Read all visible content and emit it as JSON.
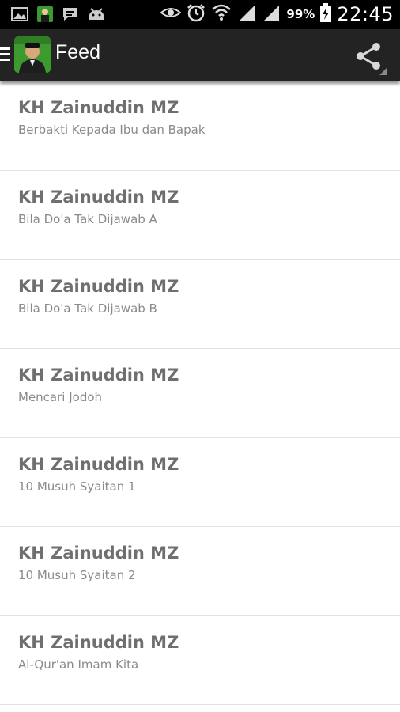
{
  "status_bar": {
    "notification_icons": [
      "gallery-icon",
      "app-icon",
      "chat-icon",
      "android-icon"
    ],
    "system_icons": [
      "eye-icon",
      "alarm-icon",
      "wifi-icon",
      "signal-icon",
      "signal-icon",
      "battery-icon"
    ],
    "battery_percent": "99%",
    "time": "22:45"
  },
  "action_bar": {
    "title": "Feed",
    "background": "#232323"
  },
  "feed": {
    "items": [
      {
        "title": "KH Zainuddin MZ",
        "subtitle": "Berbakti Kepada Ibu dan Bapak"
      },
      {
        "title": "KH Zainuddin MZ",
        "subtitle": "Bila Do'a Tak Dijawab A"
      },
      {
        "title": "KH Zainuddin MZ",
        "subtitle": "Bila Do'a Tak Dijawab B"
      },
      {
        "title": "KH Zainuddin MZ",
        "subtitle": "Mencari Jodoh"
      },
      {
        "title": "KH Zainuddin MZ",
        "subtitle": "10 Musuh Syaitan 1"
      },
      {
        "title": "KH Zainuddin MZ",
        "subtitle": "10 Musuh Syaitan 2"
      },
      {
        "title": "KH Zainuddin MZ",
        "subtitle": "Al-Qur'an Imam Kita"
      }
    ]
  }
}
